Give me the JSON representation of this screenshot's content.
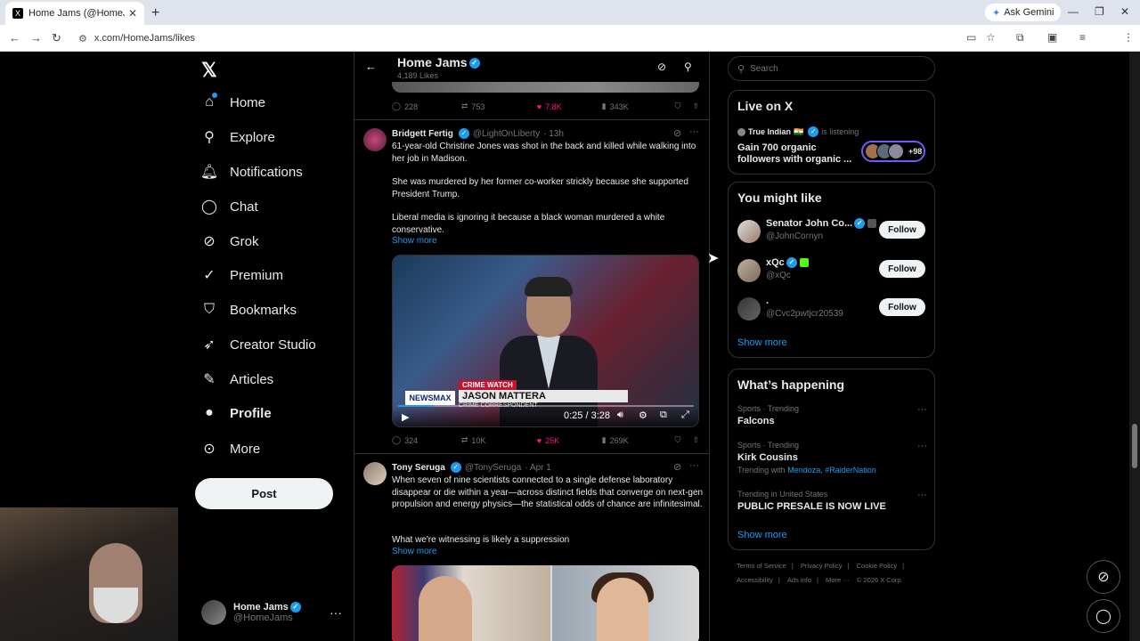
{
  "browser": {
    "tab_title": "Home Jams (@HomeJams) / X",
    "new_tab": "+",
    "gemini": "Ask Gemini",
    "url": "x.com/HomeJams/likes"
  },
  "nav": {
    "items": [
      {
        "label": "Home",
        "icon": "home-icon"
      },
      {
        "label": "Explore",
        "icon": "search-icon"
      },
      {
        "label": "Notifications",
        "icon": "bell-icon"
      },
      {
        "label": "Chat",
        "icon": "chat-icon"
      },
      {
        "label": "Grok",
        "icon": "grok-icon"
      },
      {
        "label": "Premium",
        "icon": "premium-icon"
      },
      {
        "label": "Bookmarks",
        "icon": "bookmark-icon"
      },
      {
        "label": "Creator Studio",
        "icon": "rocket-icon"
      },
      {
        "label": "Articles",
        "icon": "articles-icon"
      },
      {
        "label": "Profile",
        "icon": "profile-icon"
      },
      {
        "label": "More",
        "icon": "more-icon"
      }
    ],
    "post": "Post",
    "account_name": "Home Jams",
    "account_handle": "@HomeJams"
  },
  "header": {
    "title": "Home Jams",
    "subtitle": "4,189 Likes"
  },
  "top_actions": {
    "replies": "228",
    "reposts": "753",
    "likes": "7.8K",
    "views": "343K"
  },
  "tweet1": {
    "name": "Bridgett Fertig",
    "handle": "@LightOnLiberty",
    "time": "· 13h",
    "p1": "61-year-old Christine Jones was shot in the back and killed while walking into her job in Madison.",
    "p2": "She was murdered by her former co-worker strickly because she supported President Trump.",
    "p3": "Liberal media is ignoring it because a black woman murdered a white conservative.",
    "show_more": "Show more",
    "video": {
      "network": "NEWSMAX",
      "tag": "CRIME WATCH",
      "person": "JASON MATTERA",
      "role": "CRIME CORRESPONDENT",
      "time": "0:25 / 3:28",
      "progress": 0.12
    },
    "actions": {
      "replies": "324",
      "reposts": "10K",
      "likes": "25K",
      "views": "269K"
    }
  },
  "tweet2": {
    "name": "Tony Seruga",
    "handle": "@TonySeruga",
    "time": "· Apr 1",
    "p1": "When seven of nine scientists connected to a single defense laboratory disappear or die within a year—across distinct fields that converge on next-gen propulsion and energy physics—the statistical odds of chance are infinitesimal.",
    "p2": "What we're witnessing is likely a suppression",
    "show_more": "Show more"
  },
  "right": {
    "search_placeholder": "Search",
    "live": {
      "title": "Live on X",
      "host": "True Indian",
      "host_flag": "🇮🇳",
      "status": "is listening",
      "space_title": "Gain 700 organic followers with organic ...",
      "count": "+98"
    },
    "wtf": {
      "title": "You might like",
      "users": [
        {
          "name": "Senator John Co...",
          "handle": "@JohnCornyn",
          "follow": "Follow"
        },
        {
          "name": "xQc",
          "handle": "@xQc",
          "follow": "Follow"
        },
        {
          "name": ".",
          "handle": "@Cvc2pwtjcr20539",
          "follow": "Follow"
        }
      ],
      "show_more": "Show more"
    },
    "trends": {
      "title": "What’s happening",
      "items": [
        {
          "category": "Sports · Trending",
          "title": "Falcons",
          "with_label": "",
          "with": ""
        },
        {
          "category": "Sports · Trending",
          "title": "Kirk Cousins",
          "with_label": "Trending with",
          "with": "Mendoza, #RaiderNation"
        },
        {
          "category": "Trending in United States",
          "title": "PUBLIC PRESALE IS NOW LIVE",
          "with_label": "",
          "with": ""
        }
      ],
      "show_more": "Show more"
    },
    "footer": {
      "tos": "Terms of Service",
      "privacy": "Privacy Policy",
      "cookie": "Cookie Policy",
      "access": "Accessibility",
      "ads": "Ads info",
      "more": "More ···",
      "copy": "© 2026 X Corp."
    }
  }
}
